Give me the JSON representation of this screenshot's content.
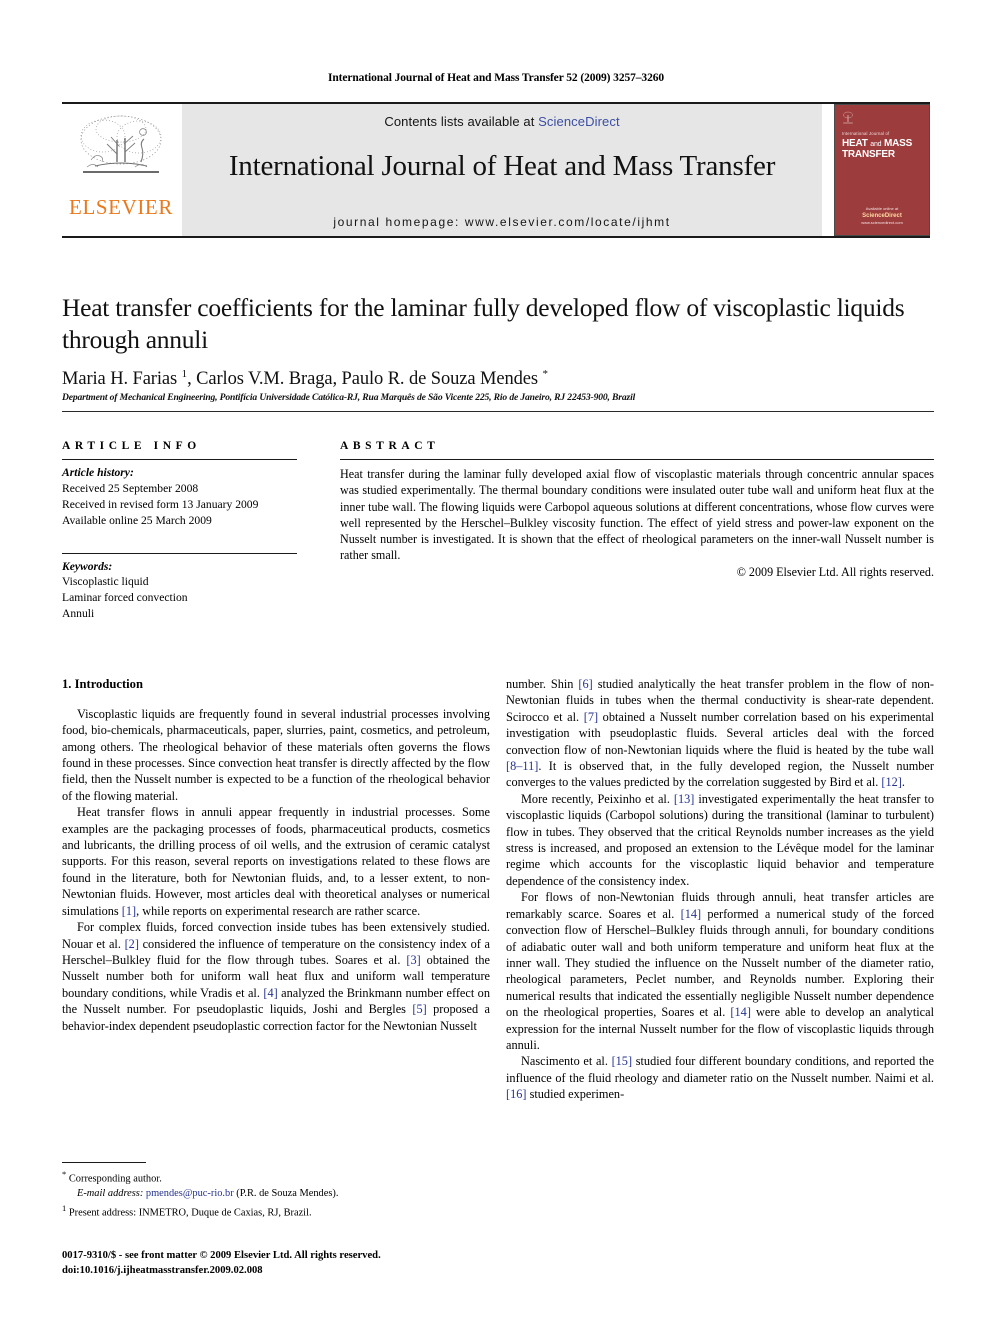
{
  "running_head": "International Journal of Heat and Mass Transfer 52 (2009) 3257–3260",
  "masthead": {
    "publisher_wordmark": "ELSEVIER",
    "contents_prefix": "Contents lists available at ",
    "contents_link": "ScienceDirect",
    "journal_name": "International Journal of Heat and Mass Transfer",
    "homepage_line": "journal homepage: www.elsevier.com/locate/ijhmt",
    "cover": {
      "kicker": "International Journal of",
      "line1": "HEAT",
      "line1_mid": "and",
      "line1_end": "MASS",
      "line2": "TRANSFER",
      "footer_top": "Available online at",
      "footer_brand": "ScienceDirect",
      "footer_url": "www.sciencedirect.com",
      "color": "#9d3c3d"
    },
    "accent_orange": "#E9791C",
    "link_blue": "#3a4ea3",
    "band_gray": "#e6e6e6"
  },
  "article": {
    "title": "Heat transfer coefficients for the laminar fully developed flow of viscoplastic liquids through annuli",
    "authors_html": "Maria H. Farias <sup>1</sup>, Carlos V.M. Braga, Paulo R. de Souza Mendes <sup>*</sup>",
    "authors_plain": "Maria H. Farias 1, Carlos V.M. Braga, Paulo R. de Souza Mendes *",
    "affiliation": "Department of Mechanical Engineering, Pontifícia Universidade Católica-RJ, Rua Marquês de São Vicente 225, Rio de Janeiro, RJ 22453-900, Brazil"
  },
  "article_info": {
    "heading": "ARTICLE INFO",
    "history_label": "Article history:",
    "history": [
      "Received 25 September 2008",
      "Received in revised form 13 January 2009",
      "Available online 25 March 2009"
    ],
    "keywords_label": "Keywords:",
    "keywords": [
      "Viscoplastic liquid",
      "Laminar forced convection",
      "Annuli"
    ]
  },
  "abstract": {
    "heading": "ABSTRACT",
    "text": "Heat transfer during the laminar fully developed axial flow of viscoplastic materials through concentric annular spaces was studied experimentally. The thermal boundary conditions were insulated outer tube wall and uniform heat flux at the inner tube wall. The flowing liquids were Carbopol aqueous solutions at different concentrations, whose flow curves were well represented by the Herschel–Bulkley viscosity function. The effect of yield stress and power-law exponent on the Nusselt number is investigated. It is shown that the effect of rheological parameters on the inner-wall Nusselt number is rather small.",
    "copyright": "© 2009 Elsevier Ltd. All rights reserved."
  },
  "body": {
    "section_number_title": "1. Introduction",
    "left_paragraphs": [
      "Viscoplastic liquids are frequently found in several industrial processes involving food, bio-chemicals, pharmaceuticals, paper, slurries, paint, cosmetics, and petroleum, among others. The rheological behavior of these materials often governs the flows found in these processes. Since convection heat transfer is directly affected by the flow field, then the Nusselt number is expected to be a function of the rheological behavior of the flowing material.",
      "Heat transfer flows in annuli appear frequently in industrial processes. Some examples are the packaging processes of foods, pharmaceutical products, cosmetics and lubricants, the drilling process of oil wells, and the extrusion of ceramic catalyst supports. For this reason, several reports on investigations related to these flows are found in the literature, both for Newtonian fluids, and, to a lesser extent, to non-Newtonian fluids. However, most articles deal with theoretical analyses or numerical simulations [1], while reports on experimental research are rather scarce.",
      "For complex fluids, forced convection inside tubes has been extensively studied. Nouar et al. [2] considered the influence of temperature on the consistency index of a Herschel–Bulkley fluid for the flow through tubes. Soares et al. [3] obtained the Nusselt number both for uniform wall heat flux and uniform wall temperature boundary conditions, while Vradis et al. [4] analyzed the Brinkmann number effect on the Nusselt number. For pseudoplastic liquids, Joshi and Bergles [5] proposed a behavior-index dependent pseudoplastic correction factor for the Newtonian Nusselt"
    ],
    "right_paragraphs": [
      "number. Shin [6] studied analytically the heat transfer problem in the flow of non-Newtonian fluids in tubes when the thermal conductivity is shear-rate dependent. Scirocco et al. [7] obtained a Nusselt number correlation based on his experimental investigation with pseudoplastic fluids. Several articles deal with the forced convection flow of non-Newtonian liquids where the fluid is heated by the tube wall [8–11]. It is observed that, in the fully developed region, the Nusselt number converges to the values predicted by the correlation suggested by Bird et al. [12].",
      "More recently, Peixinho et al. [13] investigated experimentally the heat transfer to viscoplastic liquids (Carbopol solutions) during the transitional (laminar to turbulent) flow in tubes. They observed that the critical Reynolds number increases as the yield stress is increased, and proposed an extension to the Lévêque model for the laminar regime which accounts for the viscoplastic liquid behavior and temperature dependence of the consistency index.",
      "For flows of non-Newtonian fluids through annuli, heat transfer articles are remarkably scarce. Soares et al. [14] performed a numerical study of the forced convection flow of Herschel–Bulkley fluids through annuli, for boundary conditions of adiabatic outer wall and both uniform temperature and uniform heat flux at the inner wall. They studied the influence on the Nusselt number of the diameter ratio, rheological parameters, Peclet number, and Reynolds number. Exploring their numerical results that indicated the essentially negligible Nusselt number dependence on the rheological properties, Soares et al. [14] were able to develop an analytical expression for the internal Nusselt number for the flow of viscoplastic liquids through annuli.",
      "Nascimento et al. [15] studied four different boundary conditions, and reported the influence of the fluid rheology and diameter ratio on the Nusselt number. Naimi et al. [16] studied experimen-"
    ]
  },
  "footnotes": {
    "corresponding_mark": "*",
    "corresponding_text": "Corresponding author.",
    "email_label": "E-mail address:",
    "email": "pmendes@puc-rio.br",
    "email_owner": "(P.R. de Souza Mendes).",
    "present_mark": "1",
    "present_text": "Present address: INMETRO, Duque de Caxias, RJ, Brazil."
  },
  "imprint": {
    "line1": "0017-9310/$ - see front matter © 2009 Elsevier Ltd. All rights reserved.",
    "line2": "doi:10.1016/j.ijheatmasstransfer.2009.02.008"
  }
}
